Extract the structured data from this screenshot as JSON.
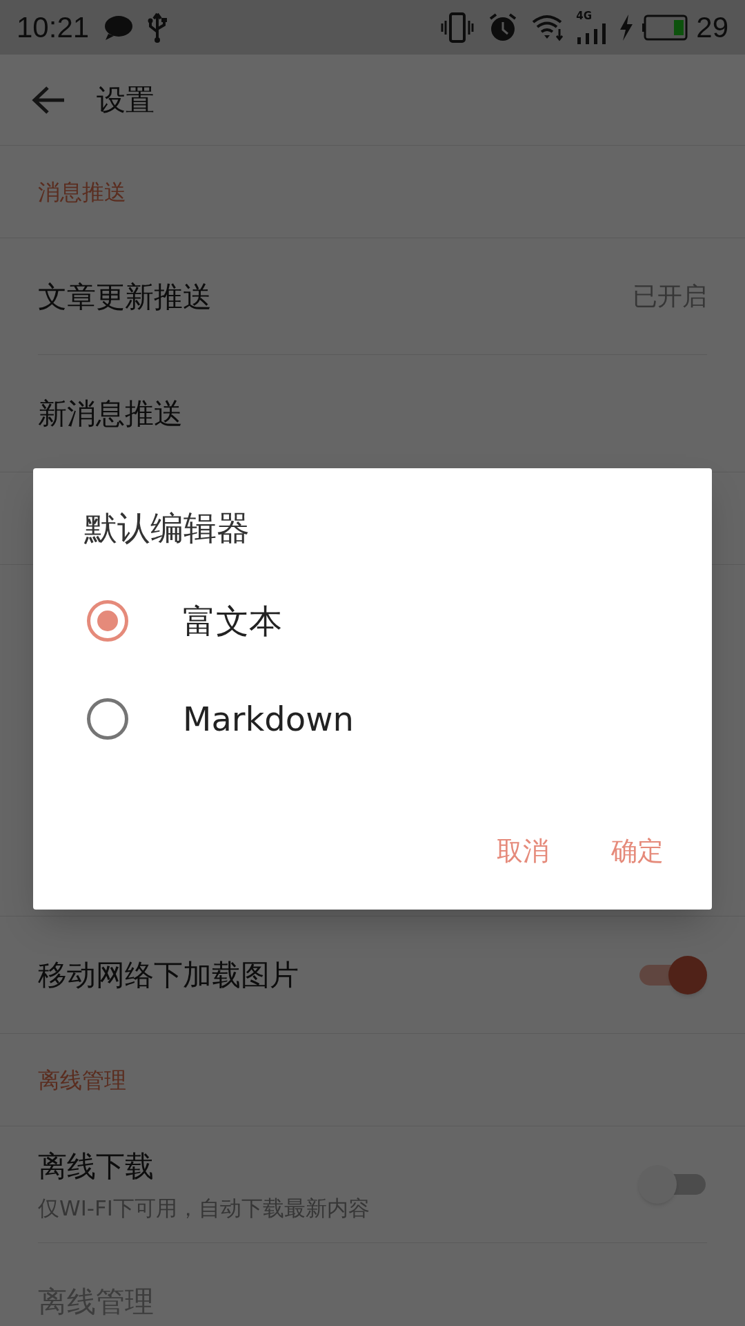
{
  "status_bar": {
    "time": "10:21",
    "network_type": "4G",
    "battery": "29"
  },
  "app_bar": {
    "title": "设置"
  },
  "sections": [
    {
      "header": "消息推送",
      "rows": [
        {
          "kind": "value",
          "title": "文章更新推送",
          "value": "已开启",
          "disabled": false
        },
        {
          "kind": "plain",
          "title": "新消息推送",
          "disabled": false
        }
      ]
    },
    {
      "rows": [
        {
          "kind": "toggle",
          "title": "移动网络下加载图片",
          "on": true,
          "disabled": false
        }
      ]
    },
    {
      "header": "离线管理",
      "rows": [
        {
          "kind": "toggle",
          "title": "离线下载",
          "subtitle": "仅WI-FI下可用，自动下载最新内容",
          "on": false,
          "disabled": false
        },
        {
          "kind": "plain",
          "title": "离线管理",
          "disabled": true
        }
      ]
    }
  ],
  "dialog": {
    "title": "默认编辑器",
    "options": [
      {
        "label": "富文本",
        "selected": true
      },
      {
        "label": "Markdown",
        "selected": false
      }
    ],
    "buttons": [
      "取消",
      "确定"
    ]
  }
}
